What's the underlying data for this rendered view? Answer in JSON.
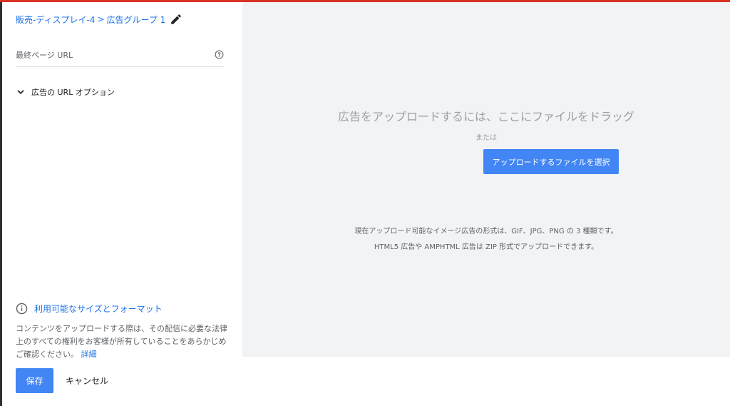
{
  "breadcrumb": {
    "campaign": "販売-ディスプレイ-4",
    "separator": ">",
    "ad_group": "広告グループ 1"
  },
  "url_field": {
    "placeholder": "最終ページ URL"
  },
  "url_options": {
    "label": "広告の URL オプション"
  },
  "formats_link": {
    "label": "利用可能なサイズとフォーマット"
  },
  "disclaimer": {
    "text": "コンテンツをアップロードする際は、その配信に必要な法律上のすべての権利をお客様が所有していることをあらかじめご確認ください。",
    "link": "詳細"
  },
  "actions": {
    "save_label": "保存",
    "cancel_label": "キャンセル"
  },
  "dropzone": {
    "title": "広告をアップロードするには、ここにファイルをドラッグ",
    "or_text": "または",
    "button_label": "アップロードするファイルを選択",
    "formats_line1": "現在アップロード可能なイメージ広告の形式は、GIF、JPG、PNG の 3 種類です。",
    "formats_line2": "HTML5 広告や AMPHTML 広告は ZIP 形式でアップロードできます。"
  },
  "colors": {
    "accent": "#4285f4",
    "link": "#1a73e8",
    "top_bar": "#d93025",
    "dropzone_bg": "#f1f3f4"
  },
  "icons": [
    "edit-icon",
    "help-icon",
    "chevron-down-icon",
    "info-icon"
  ]
}
